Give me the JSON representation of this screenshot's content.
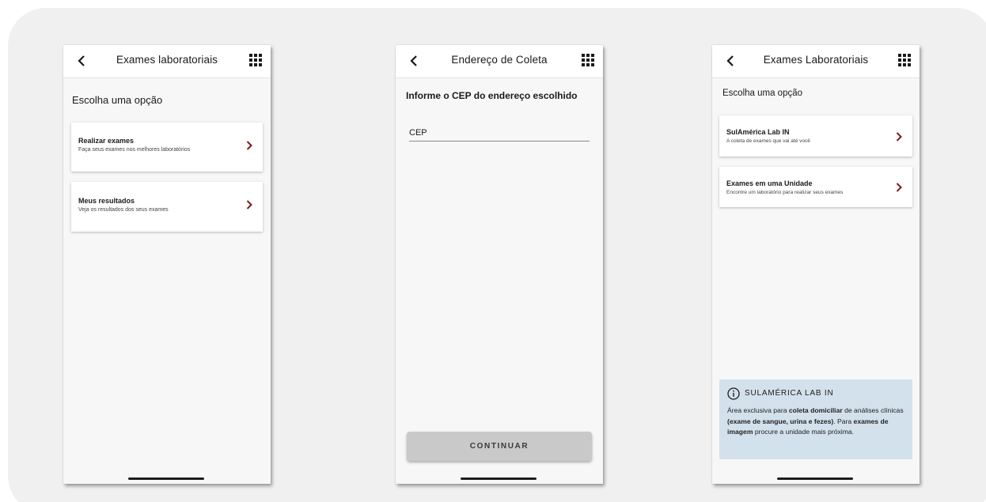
{
  "screen1": {
    "title": "Exames laboratoriais",
    "heading": "Escolha uma opção",
    "cards": [
      {
        "title": "Realizar exames",
        "subtitle": "Faça seus exames nos melhores laboratórios"
      },
      {
        "title": "Meus resultados",
        "subtitle": "Veja os resultados dos seus exames"
      }
    ]
  },
  "screen2": {
    "title": "Endereço de Coleta",
    "heading": "Informe o CEP do endereço escolhido",
    "cep_label": "CEP",
    "cep_value": "",
    "continue_label": "CONTINUAR"
  },
  "screen3": {
    "title": "Exames Laboratoriais",
    "heading": "Escolha uma opção",
    "cards": [
      {
        "title": "SulAmérica Lab IN",
        "subtitle": "A coleta de exames que vai até você"
      },
      {
        "title": "Exames em uma Unidade",
        "subtitle": "Encontre um laboratório para realizar seus exames"
      }
    ],
    "info": {
      "title": "SULAMÉRICA LAB IN",
      "t1": "Área exclusiva para ",
      "b1": "coleta domiciliar",
      "t2": " de análises clínicas ",
      "b2": "(exame de sangue, urina e fezes)",
      "t3": ". Para ",
      "b3": "exames de imagem",
      "t4": " procure a unidade mais próxima."
    }
  },
  "icons": {
    "back": "chevron-left-icon",
    "menu": "grid-menu-icon",
    "chevron": "chevron-right-icon",
    "info": "info-icon"
  },
  "colors": {
    "chevron": "#7a1e1e",
    "info_bg": "#d3e1ec",
    "button_bg": "#c9c9c9"
  }
}
